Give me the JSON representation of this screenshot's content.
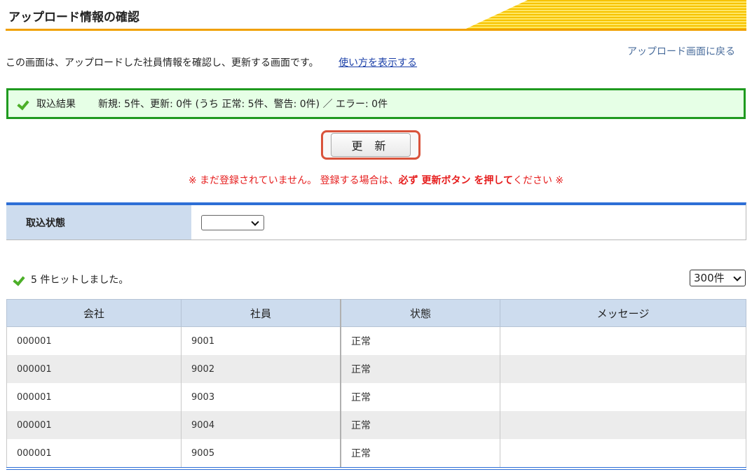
{
  "header": {
    "title": "アップロード情報の確認"
  },
  "back_link": "アップロード画面に戻る",
  "intro": {
    "text": "この画面は、アップロードした社員情報を確認し、更新する画面です。",
    "howto": "使い方を表示する"
  },
  "result": {
    "label": "取込結果",
    "summary": "新規: 5件、更新: 0件 (うち 正常: 5件、警告: 0件) ／ エラー: 0件"
  },
  "update_button": "更 新",
  "warning": {
    "part1": "※ まだ登録されていません。 登録する場合は、",
    "bold1": "必ず 更新ボタン を押して",
    "part2": "ください ※"
  },
  "filter": {
    "label": "取込状態",
    "value": ""
  },
  "hits": "5 件ヒットしました。",
  "per_page": "300件",
  "table": {
    "headers": [
      "会社",
      "社員",
      "状態",
      "メッセージ"
    ],
    "rows": [
      [
        "000001",
        "9001",
        "正常",
        ""
      ],
      [
        "000001",
        "9002",
        "正常",
        ""
      ],
      [
        "000001",
        "9003",
        "正常",
        ""
      ],
      [
        "000001",
        "9004",
        "正常",
        ""
      ],
      [
        "000001",
        "9005",
        "正常",
        ""
      ]
    ]
  },
  "colors": {
    "accent_green": "#1f9a1f",
    "accent_blue": "#2e6fd6",
    "warning_red": "#e61d1d",
    "header_orange": "#f0a000"
  }
}
